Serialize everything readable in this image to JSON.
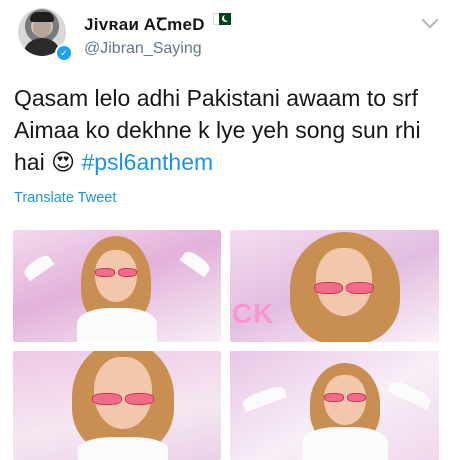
{
  "tweet": {
    "display_name": "Jiᴠʀaᴎ AꞆmeD",
    "handle": "@Jibran_Saying",
    "text_main": "Qasam lelo adhi Pakistani awaam to srf Aimaa ko dekhne k lye yeh song sun rhi hai ",
    "emoji": "😍",
    "hashtag": "#psl6anthem",
    "translate_label": "Translate Tweet",
    "flag_icon": "pakistan-flag-icon",
    "verified_icon": "verified-badge-icon",
    "menu_icon": "chevron-down-icon"
  },
  "media": {
    "photos": [
      {
        "id": "photo-1"
      },
      {
        "id": "photo-2",
        "overlay": "CK"
      },
      {
        "id": "photo-3"
      },
      {
        "id": "photo-4"
      }
    ]
  },
  "colors": {
    "link": "#1b95e0",
    "secondary_text": "#657786",
    "primary_text": "#14171a"
  }
}
